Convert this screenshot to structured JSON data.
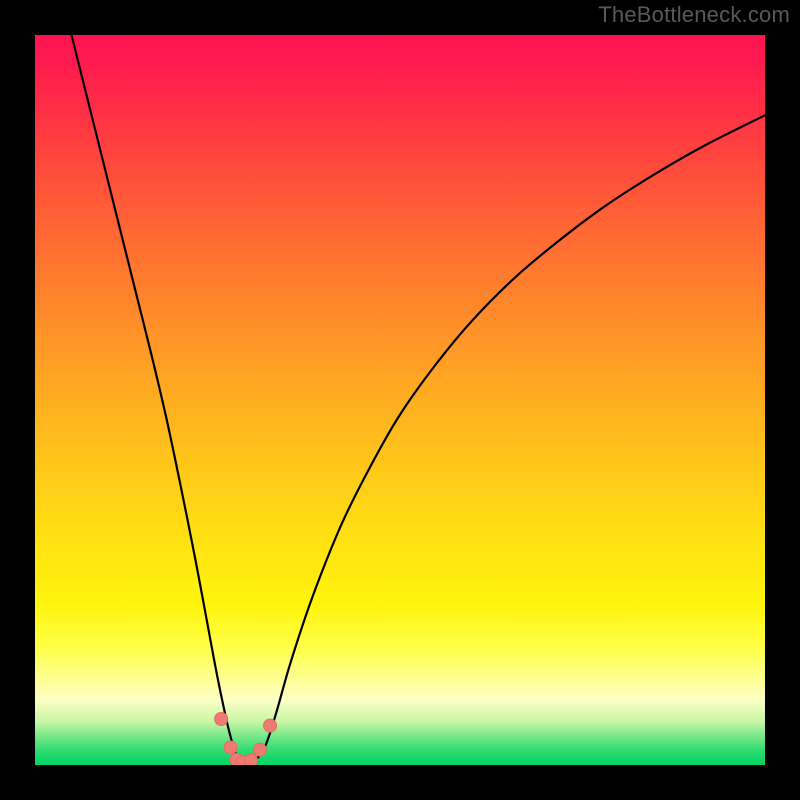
{
  "watermark": {
    "text": "TheBottleneck.com"
  },
  "colors": {
    "black": "#000000",
    "watermark": "#595959",
    "curve_stroke": "#000000",
    "marker_fill": "#ee7b73",
    "marker_stroke": "#e86a62",
    "gradient_top": "#ff1452",
    "gradient_bottom": "#00d463"
  },
  "chart_data": {
    "type": "line",
    "title": "",
    "xlabel": "",
    "ylabel": "",
    "xlim": [
      0,
      100
    ],
    "ylim": [
      0,
      100
    ],
    "x": [
      5,
      6,
      8,
      10,
      12,
      14,
      16,
      18,
      20,
      22,
      23.5,
      25,
      26.5,
      27.5,
      28,
      29,
      30,
      31.5,
      33,
      35,
      38,
      42,
      46,
      50,
      55,
      60,
      66,
      72,
      78,
      85,
      92,
      100
    ],
    "y": [
      100,
      96,
      88,
      80,
      72,
      64,
      56,
      47.5,
      38,
      28,
      20,
      12,
      5,
      1.5,
      0.3,
      0.2,
      0.5,
      2.5,
      7,
      14,
      23,
      33,
      41,
      48,
      55,
      61,
      67,
      72,
      76.5,
      81,
      85,
      89
    ],
    "markers": {
      "x": [
        25.5,
        26.8,
        27.6,
        28.4,
        29.6,
        30.8,
        32.2
      ],
      "y": [
        6.3,
        2.4,
        0.7,
        0.35,
        0.6,
        2.1,
        5.4
      ]
    }
  }
}
